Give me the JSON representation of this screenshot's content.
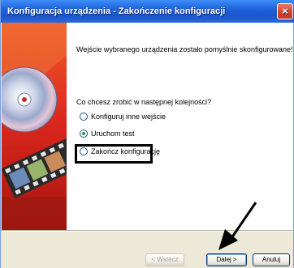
{
  "window": {
    "title": "Konfiguracja urządzenia - Zakończenie konfiguracji",
    "close_glyph": "×"
  },
  "main": {
    "message": "Wejście wybranego urządzenia zostało pomyślnie skonfigurowane!",
    "question": "Co chcesz zrobić w następnej kolejności?",
    "options": [
      {
        "label": "Konfiguruj inne wejście",
        "selected": false
      },
      {
        "label": "Uruchom test",
        "selected": true
      },
      {
        "label": "Zakończ konfigurację",
        "selected": false
      }
    ]
  },
  "footer": {
    "back_label": "< Wstecz",
    "next_label": "Dalej >",
    "cancel_label": "Anuluj"
  },
  "colors": {
    "titlebar": "#1f62da",
    "dialog_bg": "#ece9d8",
    "selected_radio": "#2b9a2b",
    "banner_red": "#d8261c"
  },
  "icons": {
    "banner": "cd-and-film-banner-icon",
    "arrow": "pointer-arrow-icon"
  }
}
